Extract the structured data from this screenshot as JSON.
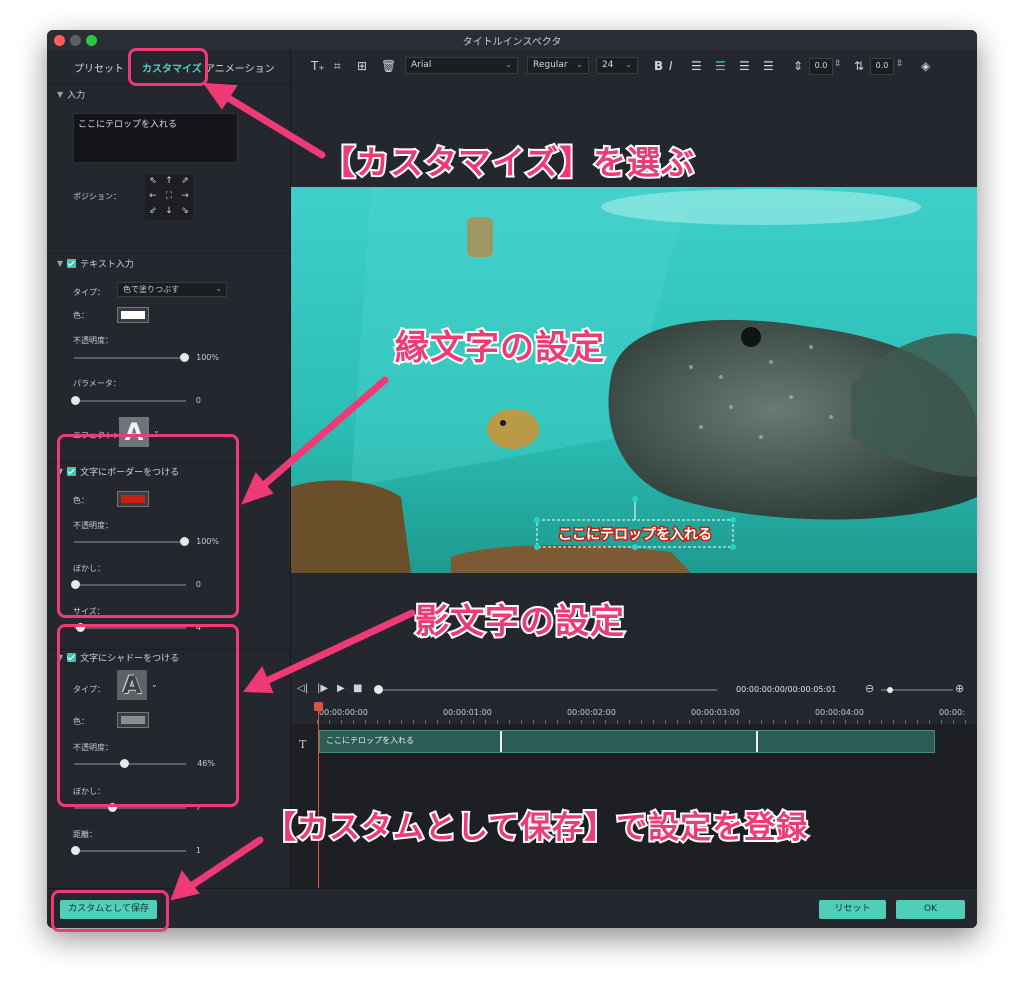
{
  "window": {
    "title": "タイトルインスペクタ"
  },
  "tabs": {
    "preset": "プリセット",
    "customize": "カスタマイズ",
    "animation": "アニメーション"
  },
  "input_section": {
    "header": "入力",
    "text_value": "ここにテロップを入れる",
    "position_label": "ポジション："
  },
  "text_fill": {
    "header": "テキスト入力",
    "type_label": "タイプ：",
    "type_value": "色で塗りつぶす",
    "color_label": "色：",
    "color": "#ffffff",
    "opacity_label": "不透明度：",
    "opacity_value": "100%",
    "opacity": 1.0,
    "parameter_label": "パラメータ：",
    "parameter_value": "0",
    "effect_label": "エフェクト："
  },
  "border": {
    "header": "文字にボーダーをつける",
    "color_label": "色：",
    "color": "#c8220f",
    "opacity_label": "不透明度：",
    "opacity_value": "100%",
    "opacity": 1.0,
    "blur_label": "ぼかし：",
    "blur_value": "0",
    "size_label": "サイズ：",
    "size_value": "4"
  },
  "shadow": {
    "header": "文字にシャドーをつける",
    "type_label": "タイプ：",
    "color_label": "色：",
    "color": "#8a8d92",
    "opacity_label": "不透明度：",
    "opacity_value": "46%",
    "opacity": 0.46,
    "blur_label": "ぼかし：",
    "blur_value": "7",
    "distance_label": "距離：",
    "distance_value": "1"
  },
  "toolbar": {
    "font": "Arial",
    "style": "Regular",
    "size": "24",
    "bold": "B",
    "italic": "I",
    "char_spacing": "0.0",
    "line_spacing": "0.0"
  },
  "preview": {
    "caption": "ここにテロップを入れる"
  },
  "playback": {
    "timecode": "00:00:00:00/00:00:05:01"
  },
  "timeline": {
    "ticks": [
      "00:00:00:00",
      "00:00:01:00",
      "00:00:02:00",
      "00:00:03:00",
      "00:00:04:00",
      "00:00:"
    ],
    "track_icon": "T",
    "clip_label": "ここにテロップを入れる"
  },
  "footer": {
    "save_custom": "カスタムとして保存",
    "reset": "リセット",
    "ok": "OK"
  },
  "annotations": {
    "choose_customize": "【カスタマイズ】を選ぶ",
    "outline_setting": "縁文字の設定",
    "shadow_setting": "影文字の設定",
    "save_register": "【カスタムとして保存】で設定を登録"
  },
  "colors": {
    "accent": "#4fcfb8",
    "annotation": "#ef3b75"
  }
}
